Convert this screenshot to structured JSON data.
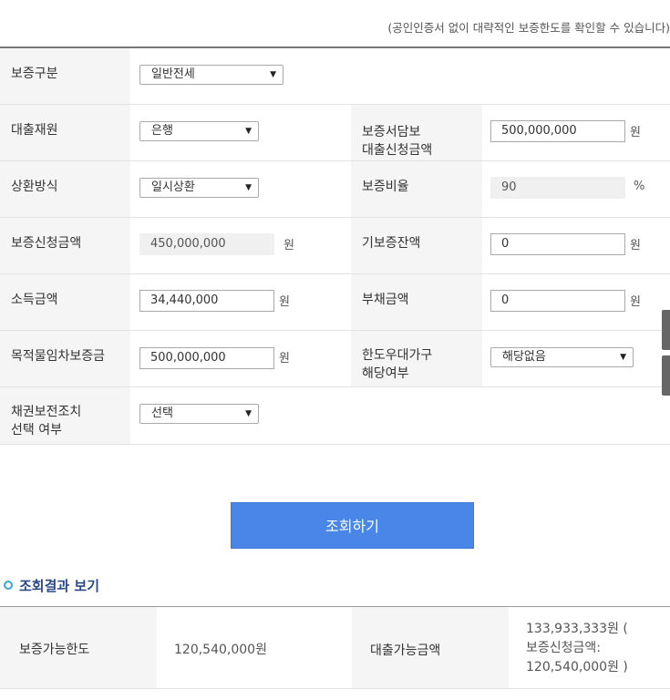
{
  "notice": "(공인인증서 없이 대략적인 보증한도를 확인할 수 있습니다)",
  "form": {
    "guarantee_type": {
      "label": "보증구분",
      "value": "일반전세"
    },
    "loan_source": {
      "label": "대출재원",
      "value": "은행"
    },
    "guarantee_loan_amount": {
      "label_line1": "보증서담보",
      "label_line2": "대출신청금액",
      "value": "500,000,000",
      "unit": "원"
    },
    "repayment_method": {
      "label": "상환방식",
      "value": "일시상환"
    },
    "guarantee_ratio": {
      "label": "보증비율",
      "value": "90",
      "unit": "%"
    },
    "guarantee_request_amount": {
      "label": "보증신청금액",
      "value": "450,000,000",
      "unit": "원"
    },
    "existing_guarantee_balance": {
      "label": "기보증잔액",
      "value": "0",
      "unit": "원"
    },
    "income_amount": {
      "label": "소득금액",
      "value": "34,440,000",
      "unit": "원"
    },
    "debt_amount": {
      "label": "부채금액",
      "value": "0",
      "unit": "원"
    },
    "lease_deposit": {
      "label": "목적물임차보증금",
      "value": "500,000,000",
      "unit": "원"
    },
    "preferential_household": {
      "label_line1": "한도우대가구",
      "label_line2": "해당여부",
      "value": "해당없음"
    },
    "bond_preservation": {
      "label_line1": "채권보전조치",
      "label_line2": "선택 여부",
      "value": "선택"
    }
  },
  "search_button": "조회하기",
  "result": {
    "section_title": "조회결과 보기",
    "guarantee_limit_label": "보증가능한도",
    "guarantee_limit_value": "120,540,000원",
    "loan_amount_label": "대출가능금액",
    "loan_amount_line1": "133,933,333원 (",
    "loan_amount_line2": "보증신청금액:",
    "loan_amount_line3": "120,540,000원 )"
  }
}
